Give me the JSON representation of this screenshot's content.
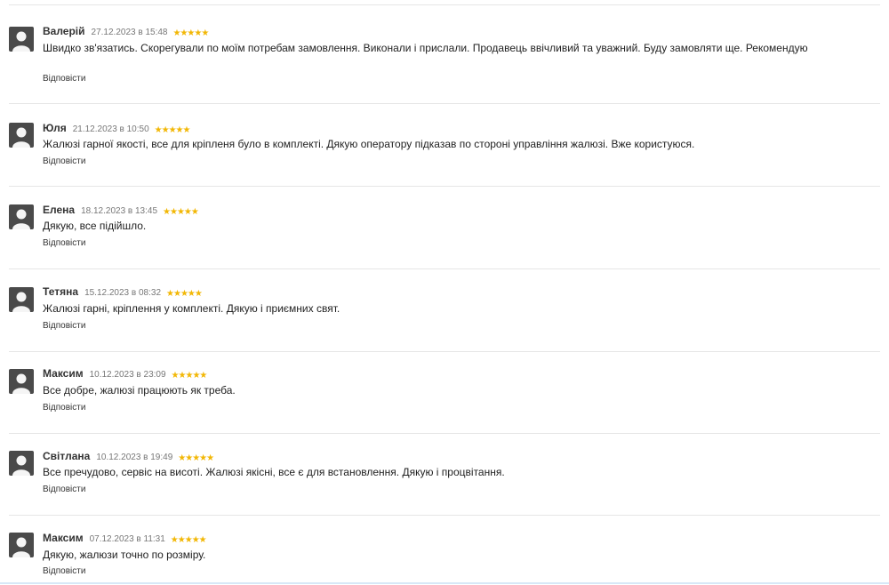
{
  "reviews": [
    {
      "author": "Валерій",
      "date": "27.12.2023 в 15:48",
      "stars": "★★★★★",
      "rating": 5,
      "text": "Швидко зв'язатись. Скорегували по моїм потребам замовлення. Виконали і прислали. Продавець ввічливий та уважний. Буду замовляти ще. Рекомендую",
      "reply": "Відповісти"
    },
    {
      "author": "Юля",
      "date": "21.12.2023 в 10:50",
      "stars": "★★★★★",
      "rating": 5,
      "text": "Жалюзі гарної якості, все для кріпленя було в комплекті. Дякую оператору підказав по стороні управління жалюзі. Вже користуюся.",
      "reply": "Відповісти"
    },
    {
      "author": "Елена",
      "date": "18.12.2023 в 13:45",
      "stars": "★★★★★",
      "rating": 5,
      "text": "Дякую, все підійшло.",
      "reply": "Відповісти"
    },
    {
      "author": "Тетяна",
      "date": "15.12.2023 в 08:32",
      "stars": "★★★★★",
      "rating": 5,
      "text": "Жалюзі гарні, кріплення у комплекті. Дякую і приємних свят.",
      "reply": "Відповісти"
    },
    {
      "author": "Максим",
      "date": "10.12.2023 в 23:09",
      "stars": "★★★★★",
      "rating": 5,
      "text": "Все добре, жалюзі працюють як треба.",
      "reply": "Відповісти"
    },
    {
      "author": "Світлана",
      "date": "10.12.2023 в 19:49",
      "stars": "★★★★★",
      "rating": 5,
      "text": "Все пречудово, сервіс на висоті. Жалюзі якісні, все є для встановлення. Дякую і процвітання.",
      "reply": "Відповісти"
    },
    {
      "author": "Максим",
      "date": "07.12.2023 в 11:31",
      "stars": "★★★★★",
      "rating": 5,
      "text": "Дякую, жалюзи точно по розміру.",
      "reply": "Відповісти"
    }
  ],
  "colors": {
    "star": "#f2b705",
    "avatar": "#4a4a4a",
    "divider": "#e6e6e6"
  },
  "icons": {
    "avatar": "user-silhouette-icon",
    "rating": "star-icon"
  }
}
